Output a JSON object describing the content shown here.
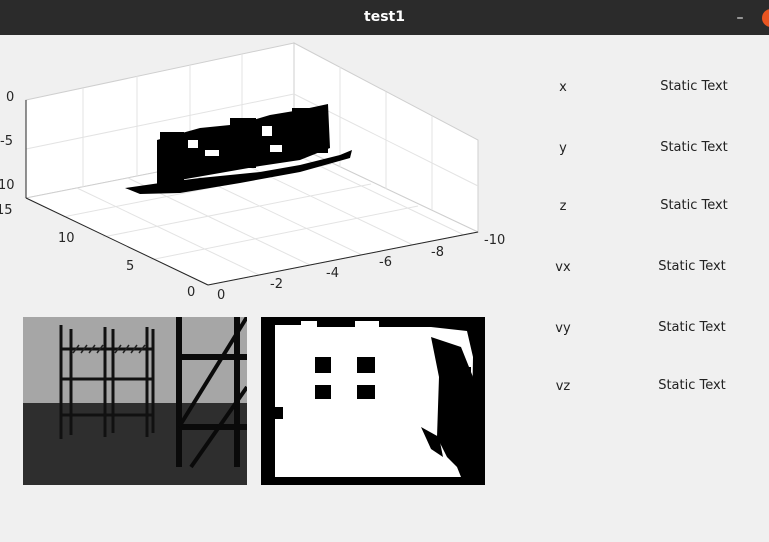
{
  "window": {
    "title": "test1",
    "minimize_glyph": "–"
  },
  "axes3d": {
    "z_ticks": [
      "0",
      "-5",
      "10"
    ],
    "y_ticks": [
      "15",
      "10",
      "5",
      "0"
    ],
    "x_ticks": [
      "0",
      "-2",
      "-4",
      "-6",
      "-8",
      "-10"
    ],
    "grid": true
  },
  "camera_view": {
    "icon": "camera-image-icon"
  },
  "depth_mask": {
    "icon": "binary-mask-image-icon"
  },
  "readouts": [
    {
      "label": "x",
      "value": "Static Text"
    },
    {
      "label": "y",
      "value": "Static Text"
    },
    {
      "label": "z",
      "value": "Static Text"
    },
    {
      "label": "vx",
      "value": "Static Text"
    },
    {
      "label": "vy",
      "value": "Static Text"
    },
    {
      "label": "vz",
      "value": "Static Text"
    }
  ],
  "colors": {
    "titlebar": "#2b2b2b",
    "close": "#e95420",
    "background": "#f0f0f0"
  }
}
